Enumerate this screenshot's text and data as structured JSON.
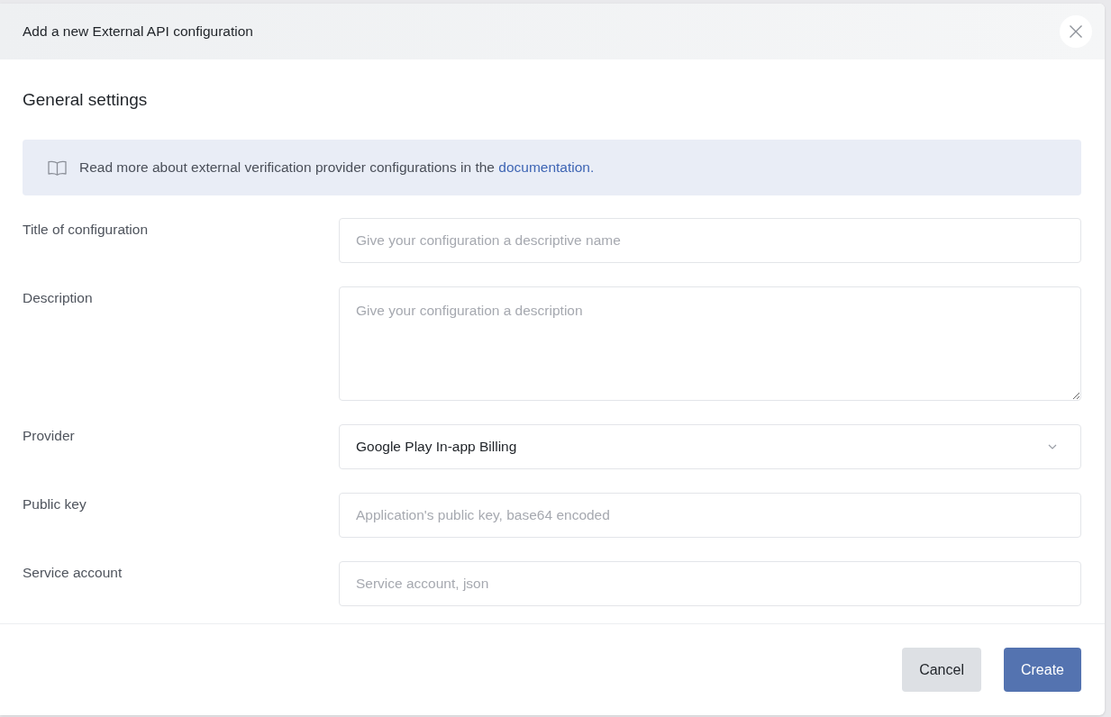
{
  "dialog": {
    "title": "Add a new External API configuration"
  },
  "section_title": "General settings",
  "info_banner": {
    "text": "Read more about external verification provider configurations in the",
    "link": "documentation."
  },
  "fields": [
    {
      "label": "Title of configuration",
      "kind": "input",
      "placeholder": "Give your configuration a descriptive name"
    },
    {
      "label": "Description",
      "kind": "textarea",
      "placeholder": "Give your configuration a description"
    },
    {
      "label": "Provider",
      "kind": "select",
      "value": "Google Play In-app Billing"
    },
    {
      "label": "Public key",
      "kind": "input",
      "placeholder": "Application's public key, base64 encoded"
    },
    {
      "label": "Service account",
      "kind": "input",
      "placeholder": "Service account, json"
    }
  ],
  "buttons": [
    {
      "label": "Cancel",
      "kind": "secondary"
    },
    {
      "label": "Create",
      "kind": "primary"
    }
  ]
}
